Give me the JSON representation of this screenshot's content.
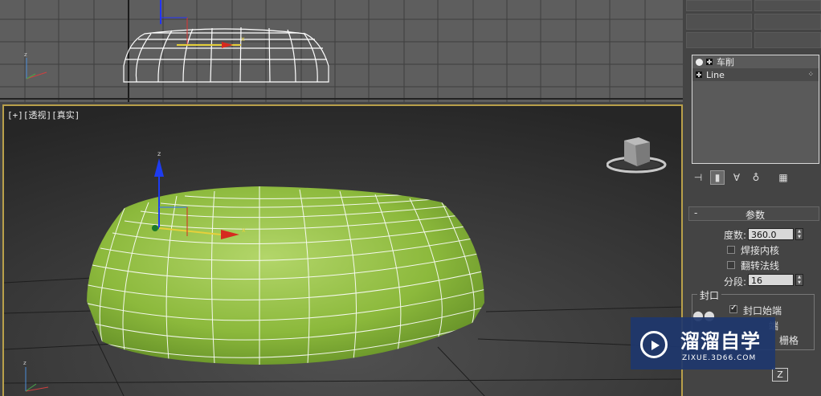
{
  "viewport_label": "[+][透视][真实]",
  "modifier_stack": {
    "items": [
      {
        "label": "车削"
      },
      {
        "label": "Line"
      }
    ]
  },
  "parameters": {
    "rollout_title": "参数",
    "degrees_label": "度数:",
    "degrees_value": "360.0",
    "weld_core_label": "焊接内核",
    "flip_normals_label": "翻转法线",
    "segments_label": "分段:",
    "segments_value": "16",
    "capping_legend": "封口",
    "cap_start_label": "封口始端",
    "cap_end_partial": "端",
    "grid_partial": "栅格",
    "z_label": "Z",
    "cap_start_checked": true,
    "weld_core_checked": false,
    "flip_normals_checked": false
  },
  "watermark": {
    "title": "溜溜自学",
    "subtitle": "ZIXUE.3D66.COM"
  },
  "colors": {
    "viewport_border": "#b9a04a",
    "mesh_green": "#8fb83f",
    "watermark_bg": "#1e376e"
  },
  "icons": [
    "bulb-icon",
    "expand-icon",
    "pin-icon",
    "modifier-icon",
    "funnel-icon",
    "remove-icon",
    "configure-icon",
    "view-cube-icon",
    "axis-tripod-icon"
  ]
}
